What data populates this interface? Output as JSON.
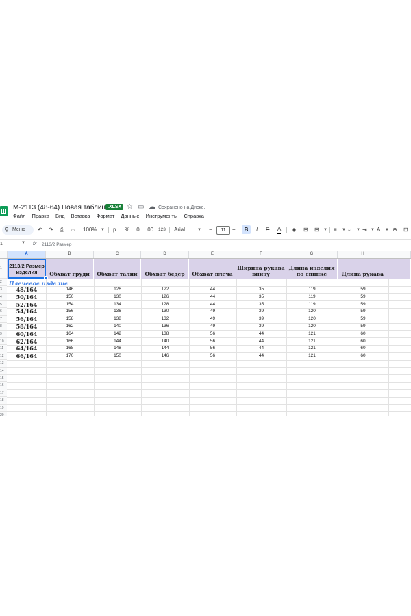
{
  "app": {
    "doc_title": "M-2113 (48-64) Новая таблица",
    "file_badge": ".XLSX",
    "saved_status": "Сохранено на Диске.",
    "star_icon": "star-icon",
    "folder_icon": "folder-move-icon",
    "cloud_icon": "cloud-saved-icon",
    "brand_color": "#0f9d58"
  },
  "menu": {
    "items": [
      "Файл",
      "Правка",
      "Вид",
      "Вставка",
      "Формат",
      "Данные",
      "Инструменты",
      "Справка"
    ]
  },
  "toolbar": {
    "search_label": "Меню",
    "zoom": "100%",
    "currency": "р.",
    "percent": "%",
    "decrease_decimals": ".0",
    "increase_decimals": ".00",
    "number_format": "123",
    "font_name": "Arial",
    "font_size": "11",
    "minus": "−",
    "plus": "+",
    "bold": "B",
    "text_color": "A"
  },
  "formula_bar": {
    "cell_ref": "1",
    "fx": "fx",
    "value": "2113/2 Размер"
  },
  "sheet": {
    "columns": [
      "A",
      "B",
      "C",
      "D",
      "E",
      "F",
      "G",
      "H"
    ],
    "header": {
      "a": "2113/2 Размер изделия",
      "b": "Обхват груди",
      "c": "Обхват талии",
      "d": "Обхват бедер",
      "e": "Обхват плеча",
      "f": "Ширина рукава внизу",
      "g": "Длина изделия по спинке",
      "h": "Длина рукава"
    },
    "section_label": "Плечевое изделие",
    "row_numbers": [
      "1",
      "2",
      "3",
      "4",
      "5",
      "6",
      "7",
      "8",
      "9",
      "10",
      "11",
      "12",
      "13",
      "14",
      "15",
      "16",
      "17",
      "18",
      "19",
      "20"
    ],
    "rows": [
      [
        "48/164",
        "146",
        "126",
        "122",
        "44",
        "35",
        "119",
        "59"
      ],
      [
        "50/164",
        "150",
        "130",
        "126",
        "44",
        "35",
        "119",
        "59"
      ],
      [
        "52/164",
        "154",
        "134",
        "128",
        "44",
        "35",
        "119",
        "59"
      ],
      [
        "54/164",
        "156",
        "136",
        "130",
        "49",
        "39",
        "120",
        "59"
      ],
      [
        "56/164",
        "158",
        "138",
        "132",
        "49",
        "39",
        "120",
        "59"
      ],
      [
        "58/164",
        "162",
        "140",
        "136",
        "49",
        "39",
        "120",
        "59"
      ],
      [
        "60/164",
        "164",
        "142",
        "138",
        "56",
        "44",
        "121",
        "60"
      ],
      [
        "62/164",
        "166",
        "144",
        "140",
        "56",
        "44",
        "121",
        "60"
      ],
      [
        "64/164",
        "168",
        "148",
        "144",
        "56",
        "44",
        "121",
        "60"
      ],
      [
        "66/164",
        "170",
        "150",
        "146",
        "56",
        "44",
        "121",
        "60"
      ]
    ],
    "header_fill": "#d9d2e9",
    "section_color": "#4a86e8"
  }
}
